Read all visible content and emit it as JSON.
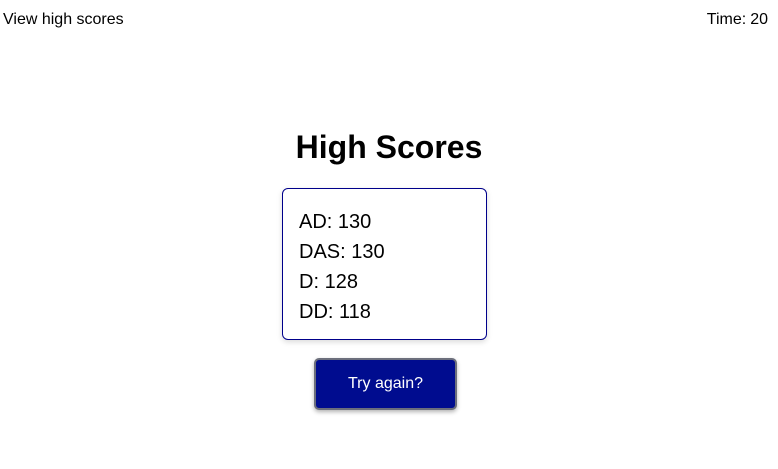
{
  "header": {
    "view_high_scores_label": "View high scores",
    "timer_label": "Time:",
    "timer_value": "20"
  },
  "main": {
    "title": "High Scores",
    "scores": [
      {
        "initials": "AD",
        "score": "130"
      },
      {
        "initials": "DAS",
        "score": "130"
      },
      {
        "initials": "D",
        "score": "128"
      },
      {
        "initials": "DD",
        "score": "118"
      }
    ],
    "try_again_label": "Try again?"
  },
  "colors": {
    "accent": "#000c8f",
    "box_border": "#00008b",
    "background": "#ffffff"
  }
}
